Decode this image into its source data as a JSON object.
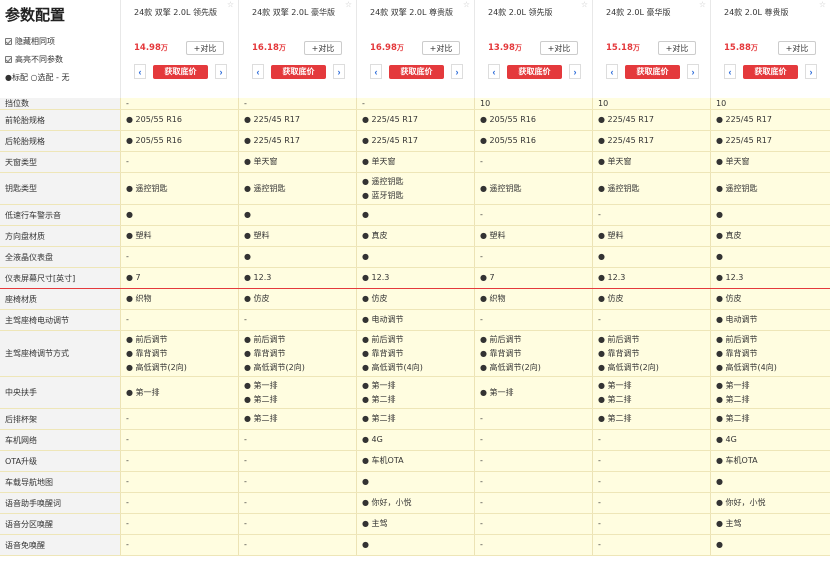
{
  "page_title": "参数配置",
  "options": [
    {
      "label": "隐藏相同项",
      "checked": true
    },
    {
      "label": "高亮不同参数",
      "checked": true
    }
  ],
  "legend": "●标配 ○选配 - 无",
  "cars": [
    {
      "name": "24款 双擎 2.0L 领先版",
      "price": "14.98",
      "unit": "万",
      "compare": "+对比",
      "quote": "获取底价"
    },
    {
      "name": "24款 双擎 2.0L 豪华版",
      "price": "16.18",
      "unit": "万",
      "compare": "+对比",
      "quote": "获取底价"
    },
    {
      "name": "24款 双擎 2.0L 尊贵版",
      "price": "16.98",
      "unit": "万",
      "compare": "+对比",
      "quote": "获取底价"
    },
    {
      "name": "24款 2.0L 领先版",
      "price": "13.98",
      "unit": "万",
      "compare": "+对比",
      "quote": "获取底价"
    },
    {
      "name": "24款 2.0L 豪华版",
      "price": "15.18",
      "unit": "万",
      "compare": "+对比",
      "quote": "获取底价"
    },
    {
      "name": "24款 2.0L 尊贵版",
      "price": "15.88",
      "unit": "万",
      "compare": "+对比",
      "quote": "获取底价"
    }
  ],
  "rows": [
    {
      "label": "挡位数",
      "h": 12,
      "cells": [
        [
          "-"
        ],
        [
          "-"
        ],
        [
          "-"
        ],
        [
          "10"
        ],
        [
          "10"
        ],
        [
          "10"
        ]
      ]
    },
    {
      "label": "前轮胎规格",
      "h": 21,
      "cells": [
        [
          "● 205/55 R16"
        ],
        [
          "● 225/45 R17"
        ],
        [
          "● 225/45 R17"
        ],
        [
          "● 205/55 R16"
        ],
        [
          "● 225/45 R17"
        ],
        [
          "● 225/45 R17"
        ]
      ]
    },
    {
      "label": "后轮胎规格",
      "h": 21,
      "cells": [
        [
          "● 205/55 R16"
        ],
        [
          "● 225/45 R17"
        ],
        [
          "● 225/45 R17"
        ],
        [
          "● 205/55 R16"
        ],
        [
          "● 225/45 R17"
        ],
        [
          "● 225/45 R17"
        ]
      ]
    },
    {
      "label": "天窗类型",
      "h": 21,
      "cells": [
        [
          "-"
        ],
        [
          "● 单天窗"
        ],
        [
          "● 单天窗"
        ],
        [
          "-"
        ],
        [
          "● 单天窗"
        ],
        [
          "● 单天窗"
        ]
      ]
    },
    {
      "label": "钥匙类型",
      "h": 32,
      "cells": [
        [
          "● 遥控钥匙"
        ],
        [
          "● 遥控钥匙"
        ],
        [
          "● 遥控钥匙",
          "● 蓝牙钥匙"
        ],
        [
          "● 遥控钥匙"
        ],
        [
          "● 遥控钥匙"
        ],
        [
          "● 遥控钥匙"
        ]
      ]
    },
    {
      "label": "低速行车警示音",
      "h": 21,
      "cells": [
        [
          "●"
        ],
        [
          "●"
        ],
        [
          "●"
        ],
        [
          "-"
        ],
        [
          "-"
        ],
        [
          "●"
        ]
      ]
    },
    {
      "label": "方向盘材质",
      "h": 21,
      "cells": [
        [
          "● 塑料"
        ],
        [
          "● 塑料"
        ],
        [
          "● 真皮"
        ],
        [
          "● 塑料"
        ],
        [
          "● 塑料"
        ],
        [
          "● 真皮"
        ]
      ]
    },
    {
      "label": "全液晶仪表盘",
      "h": 21,
      "cells": [
        [
          "-"
        ],
        [
          "●"
        ],
        [
          "●"
        ],
        [
          "-"
        ],
        [
          "●"
        ],
        [
          "●"
        ]
      ]
    },
    {
      "label": "仪表屏幕尺寸[英寸]",
      "h": 21,
      "sep": true,
      "cells": [
        [
          "● 7"
        ],
        [
          "● 12.3"
        ],
        [
          "● 12.3"
        ],
        [
          "● 7"
        ],
        [
          "● 12.3"
        ],
        [
          "● 12.3"
        ]
      ]
    },
    {
      "label": "座椅材质",
      "h": 21,
      "cells": [
        [
          "● 织物"
        ],
        [
          "● 仿皮"
        ],
        [
          "● 仿皮"
        ],
        [
          "● 织物"
        ],
        [
          "● 仿皮"
        ],
        [
          "● 仿皮"
        ]
      ]
    },
    {
      "label": "主驾座椅电动调节",
      "h": 21,
      "cells": [
        [
          "-"
        ],
        [
          "-"
        ],
        [
          "● 电动调节"
        ],
        [
          "-"
        ],
        [
          "-"
        ],
        [
          "● 电动调节"
        ]
      ]
    },
    {
      "label": "主驾座椅调节方式",
      "h": 46,
      "cells": [
        [
          "● 前后调节",
          "● 靠背调节",
          "● 高低调节(2向)"
        ],
        [
          "● 前后调节",
          "● 靠背调节",
          "● 高低调节(2向)"
        ],
        [
          "● 前后调节",
          "● 靠背调节",
          "● 高低调节(4向)"
        ],
        [
          "● 前后调节",
          "● 靠背调节",
          "● 高低调节(2向)"
        ],
        [
          "● 前后调节",
          "● 靠背调节",
          "● 高低调节(2向)"
        ],
        [
          "● 前后调节",
          "● 靠背调节",
          "● 高低调节(4向)"
        ]
      ]
    },
    {
      "label": "中央扶手",
      "h": 32,
      "cells": [
        [
          "● 第一排"
        ],
        [
          "● 第一排",
          "● 第二排"
        ],
        [
          "● 第一排",
          "● 第二排"
        ],
        [
          "● 第一排"
        ],
        [
          "● 第一排",
          "● 第二排"
        ],
        [
          "● 第一排",
          "● 第二排"
        ]
      ]
    },
    {
      "label": "后排杯架",
      "h": 21,
      "cells": [
        [
          "-"
        ],
        [
          "● 第二排"
        ],
        [
          "● 第二排"
        ],
        [
          "-"
        ],
        [
          "● 第二排"
        ],
        [
          "● 第二排"
        ]
      ]
    },
    {
      "label": "车机网络",
      "h": 21,
      "cells": [
        [
          "-"
        ],
        [
          "-"
        ],
        [
          "● 4G"
        ],
        [
          "-"
        ],
        [
          "-"
        ],
        [
          "● 4G"
        ]
      ]
    },
    {
      "label": "OTA升级",
      "h": 21,
      "cells": [
        [
          "-"
        ],
        [
          "-"
        ],
        [
          "● 车机OTA"
        ],
        [
          "-"
        ],
        [
          "-"
        ],
        [
          "● 车机OTA"
        ]
      ]
    },
    {
      "label": "车载导航地图",
      "h": 21,
      "cells": [
        [
          "-"
        ],
        [
          "-"
        ],
        [
          "●"
        ],
        [
          "-"
        ],
        [
          "-"
        ],
        [
          "●"
        ]
      ]
    },
    {
      "label": "语音助手唤醒词",
      "h": 21,
      "cells": [
        [
          "-"
        ],
        [
          "-"
        ],
        [
          "● 你好，小悦"
        ],
        [
          "-"
        ],
        [
          "-"
        ],
        [
          "● 你好，小悦"
        ]
      ]
    },
    {
      "label": "语音分区唤醒",
      "h": 21,
      "cells": [
        [
          "-"
        ],
        [
          "-"
        ],
        [
          "● 主驾"
        ],
        [
          "-"
        ],
        [
          "-"
        ],
        [
          "● 主驾"
        ]
      ]
    },
    {
      "label": "语音免唤醒",
      "h": 21,
      "cells": [
        [
          "-"
        ],
        [
          "-"
        ],
        [
          "●"
        ],
        [
          "-"
        ],
        [
          "-"
        ],
        [
          "●"
        ]
      ]
    }
  ]
}
